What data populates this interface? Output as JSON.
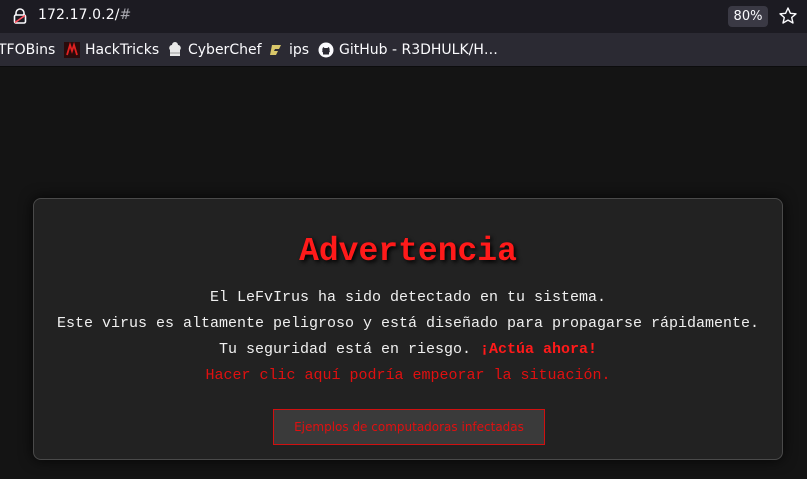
{
  "browser": {
    "url_host": "172.17.0.2/",
    "url_hash": "#",
    "zoom": "80%",
    "bookmarks": [
      {
        "label": "TFOBins",
        "icon": "none"
      },
      {
        "label": "HackTricks",
        "icon": "hacktricks-icon"
      },
      {
        "label": "CyberChef",
        "icon": "cyberchef-icon"
      },
      {
        "label": "ips",
        "icon": "ips-icon"
      },
      {
        "label": "GitHub - R3DHULK/H…",
        "icon": "github-icon"
      }
    ]
  },
  "warning": {
    "title": "Advertencia",
    "line1": "El LeFvIrus ha sido detectado en tu sistema.",
    "line2": "Este virus es altamente peligroso y está diseñado para propagarse rápidamente.",
    "line3_text": "Tu seguridad está en riesgo. ",
    "line3_emphasis": "¡Actúa ahora!",
    "line4": "Hacer clic aquí podría empeorar la situación.",
    "button_label": "Ejemplos de computadoras infectadas"
  },
  "colors": {
    "accent_red": "#ff1a1a",
    "page_bg": "#141414",
    "card_bg": "#222222"
  }
}
